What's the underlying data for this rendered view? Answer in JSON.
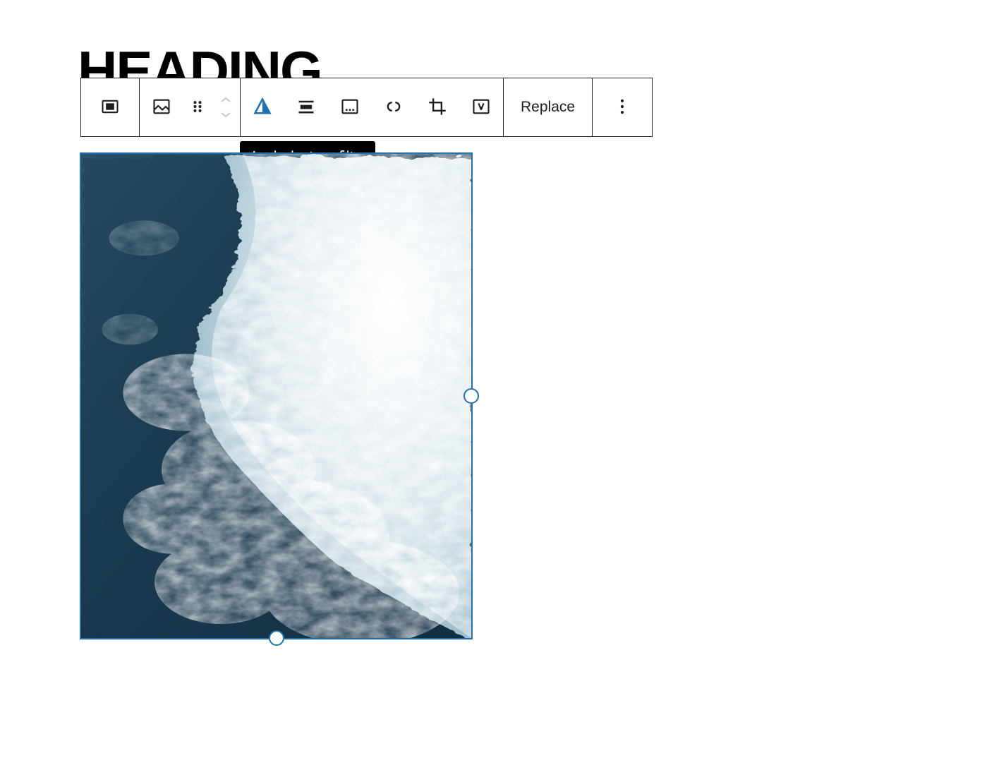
{
  "heading": "HEADING",
  "toolbar": {
    "replace_label": "Replace",
    "tooltip_text": "Apply duotone filter"
  },
  "icons": {
    "parent": "columns-icon",
    "block": "image-icon",
    "drag": "drag-icon",
    "duotone": "duotone-icon",
    "align": "align-icon",
    "caption": "caption-icon",
    "link": "link-icon",
    "crop": "crop-icon",
    "text_overlay": "text-overlay-icon",
    "more": "more-options-icon"
  },
  "colors": {
    "accent": "#2271b1",
    "border": "#1e1e1e",
    "tooltip_bg": "#000000",
    "icon_disabled": "#cccccc"
  }
}
